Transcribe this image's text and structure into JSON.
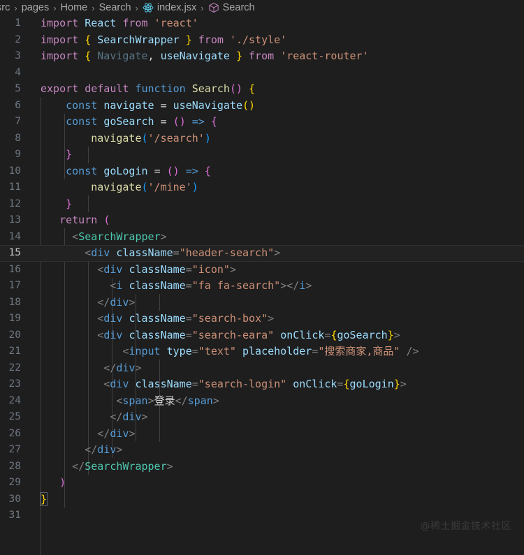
{
  "breadcrumb": {
    "name": "breadcrumb",
    "items": [
      {
        "label": "src",
        "icon": null
      },
      {
        "label": "pages",
        "icon": null
      },
      {
        "label": "Home",
        "icon": null
      },
      {
        "label": "Search",
        "icon": null
      },
      {
        "label": "index.jsx",
        "icon": "react-icon"
      },
      {
        "label": "Search",
        "icon": "symbol-class-icon"
      }
    ],
    "separator": "›"
  },
  "editor": {
    "language": "javascriptreact",
    "file": "index.jsx",
    "active_line": 15,
    "total_lines": 31,
    "line_numbers": [
      "1",
      "2",
      "3",
      "4",
      "5",
      "6",
      "7",
      "8",
      "9",
      "10",
      "11",
      "12",
      "13",
      "14",
      "15",
      "16",
      "17",
      "18",
      "19",
      "20",
      "21",
      "22",
      "23",
      "24",
      "25",
      "26",
      "27",
      "28",
      "29",
      "30",
      "31"
    ],
    "lines": [
      {
        "n": "1",
        "text": "import React from 'react'"
      },
      {
        "n": "2",
        "text": "import { SearchWrapper } from './style'"
      },
      {
        "n": "3",
        "text": "import { Navigate, useNavigate } from 'react-router'"
      },
      {
        "n": "4",
        "text": ""
      },
      {
        "n": "5",
        "text": "export default function Search() {"
      },
      {
        "n": "6",
        "text": "    const navigate = useNavigate()"
      },
      {
        "n": "7",
        "text": "    const goSearch = () => {"
      },
      {
        "n": "8",
        "text": "        navigate('/search')"
      },
      {
        "n": "9",
        "text": "    }"
      },
      {
        "n": "10",
        "text": "    const goLogin = () => {"
      },
      {
        "n": "11",
        "text": "        navigate('/mine')"
      },
      {
        "n": "12",
        "text": "    }"
      },
      {
        "n": "13",
        "text": "   return ("
      },
      {
        "n": "14",
        "text": "     <SearchWrapper>"
      },
      {
        "n": "15",
        "text": "       <div className=\"header-search\">"
      },
      {
        "n": "16",
        "text": "         <div className=\"icon\">"
      },
      {
        "n": "17",
        "text": "           <i className=\"fa fa-search\"></i>"
      },
      {
        "n": "18",
        "text": "         </div>"
      },
      {
        "n": "19",
        "text": "         <div className=\"search-box\">"
      },
      {
        "n": "20",
        "text": "         <div className=\"search-eara\" onClick={goSearch}>"
      },
      {
        "n": "21",
        "text": "             <input type=\"text\" placeholder=\"搜索商家,商品\" />"
      },
      {
        "n": "22",
        "text": "          </div>"
      },
      {
        "n": "23",
        "text": "           <div className=\"search-login\" onClick={goLogin}>"
      },
      {
        "n": "24",
        "text": "             <span>登录</span>"
      },
      {
        "n": "25",
        "text": "           </div>"
      },
      {
        "n": "26",
        "text": "         </div>"
      },
      {
        "n": "27",
        "text": "       </div>"
      },
      {
        "n": "28",
        "text": "     </SearchWrapper>"
      },
      {
        "n": "29",
        "text": "   )"
      },
      {
        "n": "30",
        "text": "}"
      },
      {
        "n": "31",
        "text": ""
      }
    ]
  },
  "code_tokens": {
    "import": "import",
    "export": "export",
    "default": "default",
    "function": "function",
    "const": "const",
    "return": "return",
    "from": "from",
    "react_ident": "React",
    "react_str": "'react'",
    "search_wrapper": "SearchWrapper",
    "style_str": "'./style'",
    "navigate_ident": "Navigate",
    "use_navigate": "useNavigate",
    "router_str": "'react-router'",
    "search_fn": "Search",
    "navigate_var": "navigate",
    "go_search": "goSearch",
    "go_login": "goLogin",
    "search_path": "'/search'",
    "mine_path": "'/mine'",
    "div": "div",
    "i": "i",
    "input": "input",
    "span": "span",
    "class_name": "className",
    "type_attr": "type",
    "placeholder_attr": "placeholder",
    "on_click": "onClick",
    "cls_header_search": "\"header-search\"",
    "cls_icon": "\"icon\"",
    "cls_fa_search": "\"fa fa-search\"",
    "cls_search_box": "\"search-box\"",
    "cls_search_eara": "\"search-eara\"",
    "cls_search_login": "\"search-login\"",
    "val_text": "\"text\"",
    "val_placeholder": "\"搜索商家,商品\"",
    "login_text": "登录",
    "arrow": "=>",
    "eq": "=",
    "lparen": "(",
    "rparen": ")",
    "lbrace": "{",
    "rbrace": "}",
    "lt": "<",
    "gt": ">",
    "lt_slash": "</",
    "slash_gt": "/>"
  },
  "colors": {
    "editor_background": "#1e1e1e",
    "active_line_background": "#222222",
    "line_number": "#6e7681",
    "active_line_number": "#c6c6c6",
    "keyword": "#c586c0",
    "control": "#569cd6",
    "variable": "#9cdcfe",
    "function": "#dcdcaa",
    "string": "#ce9178",
    "component": "#4ec9b0",
    "bracket_yellow": "#ffd700",
    "bracket_pink": "#da70d6",
    "bracket_blue": "#179fff",
    "indent_guide": "#404040",
    "watermark": "#3b3b3b"
  },
  "watermark": {
    "text": "@稀土掘金技术社区"
  }
}
